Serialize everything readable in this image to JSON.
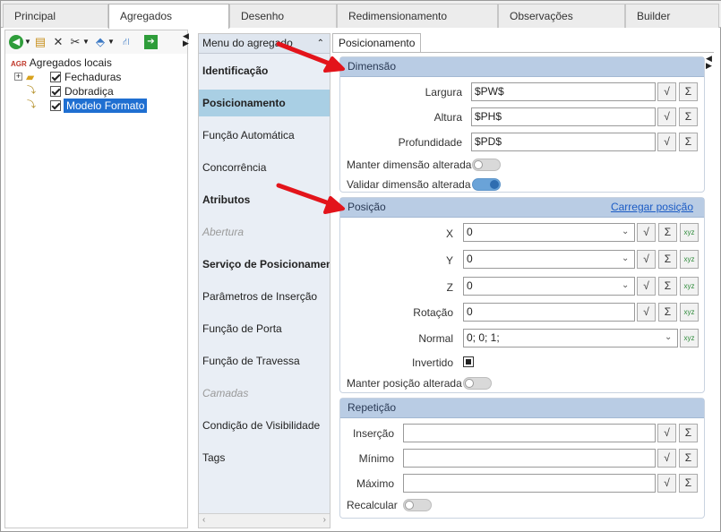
{
  "top_tabs": [
    "Principal",
    "Agregados",
    "Desenho",
    "Redimensionamento",
    "Observações",
    "Builder"
  ],
  "tree": {
    "root_label": "Agregados locais",
    "root_prefix": "AGR",
    "items": [
      "Fechaduras",
      "Dobradiça",
      "Modelo Formato"
    ]
  },
  "nav": {
    "header": "Menu do agregado",
    "items": [
      "Identificação",
      "Posicionamento",
      "Função Automática",
      "Concorrência",
      "Atributos",
      "Abertura",
      "Serviço de Posicionamento",
      "Parâmetros de Inserção",
      "Função de Porta",
      "Função de Travessa",
      "Camadas",
      "Condição de Visibilidade",
      "Tags"
    ]
  },
  "panel_tab": "Posicionamento",
  "dimensao": {
    "title": "Dimensão",
    "largura_label": "Largura",
    "largura_value": "$PW$",
    "altura_label": "Altura",
    "altura_value": "$PH$",
    "profundidade_label": "Profundidade",
    "profundidade_value": "$PD$",
    "manter_label": "Manter dimensão alterada",
    "manter_on": false,
    "validar_label": "Validar dimensão alterada",
    "validar_on": true
  },
  "posicao": {
    "title": "Posição",
    "link": "Carregar posição",
    "x_label": "X",
    "x_value": "0",
    "y_label": "Y",
    "y_value": "0",
    "z_label": "Z",
    "z_value": "0",
    "rotacao_label": "Rotação",
    "rotacao_value": "0",
    "normal_label": "Normal",
    "normal_value": "0; 0; 1;",
    "invertido_label": "Invertido",
    "manter_label": "Manter posição alterada",
    "manter_on": false
  },
  "repeticao": {
    "title": "Repetição",
    "insercao_label": "Inserção",
    "minimo_label": "Mínimo",
    "maximo_label": "Máximo",
    "recalcular_label": "Recalcular",
    "recalcular_on": false
  },
  "button_glyphs": {
    "formula": "√",
    "sum": "Σ",
    "xyz": "xyz"
  },
  "colors": {
    "accent": "#1f6fd1",
    "section_header": "#b9cce4",
    "nav_active": "#a9cfe4",
    "arrow": "#e3141b",
    "link": "#1c5cc5"
  }
}
